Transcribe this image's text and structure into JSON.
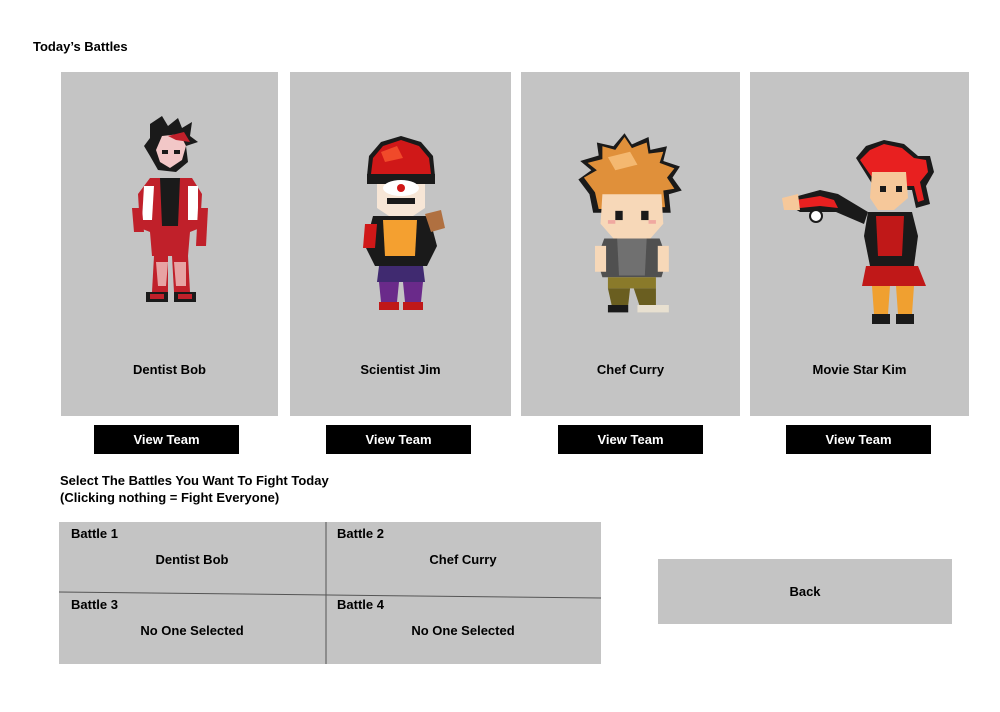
{
  "header": {
    "title": "Today’s Battles"
  },
  "trainers": [
    {
      "name": "Dentist Bob",
      "view_label": "View Team",
      "sprite_icon": "trainer-sprite-icon"
    },
    {
      "name": "Scientist Jim",
      "view_label": "View Team",
      "sprite_icon": "trainer-sprite-icon"
    },
    {
      "name": "Chef Curry",
      "view_label": "View Team",
      "sprite_icon": "trainer-sprite-icon"
    },
    {
      "name": "Movie Star Kim",
      "view_label": "View Team",
      "sprite_icon": "trainer-sprite-icon"
    }
  ],
  "selection": {
    "line1": "Select The Battles You Want To Fight Today",
    "line2": "(Clicking nothing = Fight Everyone)",
    "battles": [
      {
        "label": "Battle 1",
        "value": "Dentist Bob"
      },
      {
        "label": "Battle 2",
        "value": "Chef Curry"
      },
      {
        "label": "Battle 3",
        "value": "No One Selected"
      },
      {
        "label": "Battle 4",
        "value": "No One Selected"
      }
    ]
  },
  "back_label": "Back",
  "colors": {
    "card_bg": "#c4c4c4",
    "button_bg": "#000000",
    "button_text": "#ffffff"
  }
}
